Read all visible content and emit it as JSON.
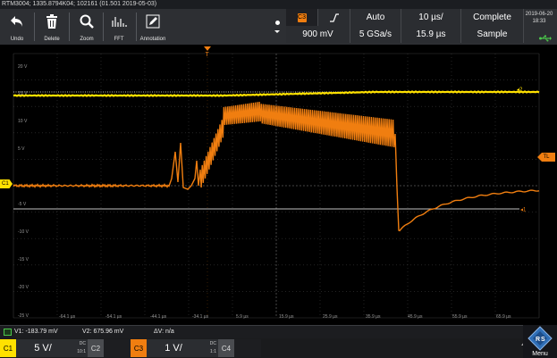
{
  "title_bar": {
    "text": "RTM3004; 1335.8794K04; 102161 (01.501 2019-05-03)"
  },
  "toolbar": {
    "undo_label": "Undo",
    "delete_label": "Delete",
    "zoom_label": "Zoom",
    "fft_label": "FFT",
    "annotation_label": "Annotation"
  },
  "trigger": {
    "channel_icon": "C3",
    "slope_icon": "rising-edge",
    "mode": "Auto",
    "level": "900 mV"
  },
  "timebase": {
    "scale": "10 µs/",
    "sample_rate": "5 GSa/s",
    "position": "15.9 µs"
  },
  "acquisition": {
    "status": "Complete",
    "mode": "Sample"
  },
  "datetime": {
    "date": "2019-06-20",
    "time": "18:33"
  },
  "y_axis_labels": [
    "20 V",
    "15 V",
    "10 V",
    "5 V",
    "-5 V",
    "-10 V",
    "-15 V",
    "-20 V",
    "-25 V"
  ],
  "x_axis_labels": [
    "-64.1 µs",
    "-54.1 µs",
    "-44.1 µs",
    "-34.1 µs",
    "-24.1 µs",
    "-14.1 µs",
    "-4.1 µs",
    "5.9 µs",
    "15.9 µs",
    "25.9 µs",
    "35.9 µs",
    "45.9 µs",
    "55.9 µs",
    "65.9 µs"
  ],
  "markers": {
    "c1": "C1",
    "tl": "TL",
    "c2_right": "2",
    "c3_right": "1",
    "trigger_t": "T"
  },
  "measurements": {
    "v1": "V1: -183.79 mV",
    "v2": "V2: 675.96 mV",
    "dv": "ΔV: n/a"
  },
  "channels": [
    {
      "tag": "C1",
      "scale": "5 V/",
      "coupling": "DC",
      "probe": "10:1",
      "color": "#ffe100"
    },
    {
      "tag": "C2",
      "scale": "",
      "coupling": "",
      "probe": "",
      "color": "#4a4c50"
    },
    {
      "tag": "C3",
      "scale": "1 V/",
      "coupling": "DC",
      "probe": "1:1",
      "color": "#f07e10"
    },
    {
      "tag": "C4",
      "scale": "",
      "coupling": "",
      "probe": "",
      "color": "#4a4c50"
    }
  ],
  "menu_label": "Menu",
  "colors": {
    "ch1_yellow": "#ffe100",
    "ch3_orange": "#f07e10",
    "cursor": "#ffffff",
    "grid": "#3a3a3a"
  }
}
